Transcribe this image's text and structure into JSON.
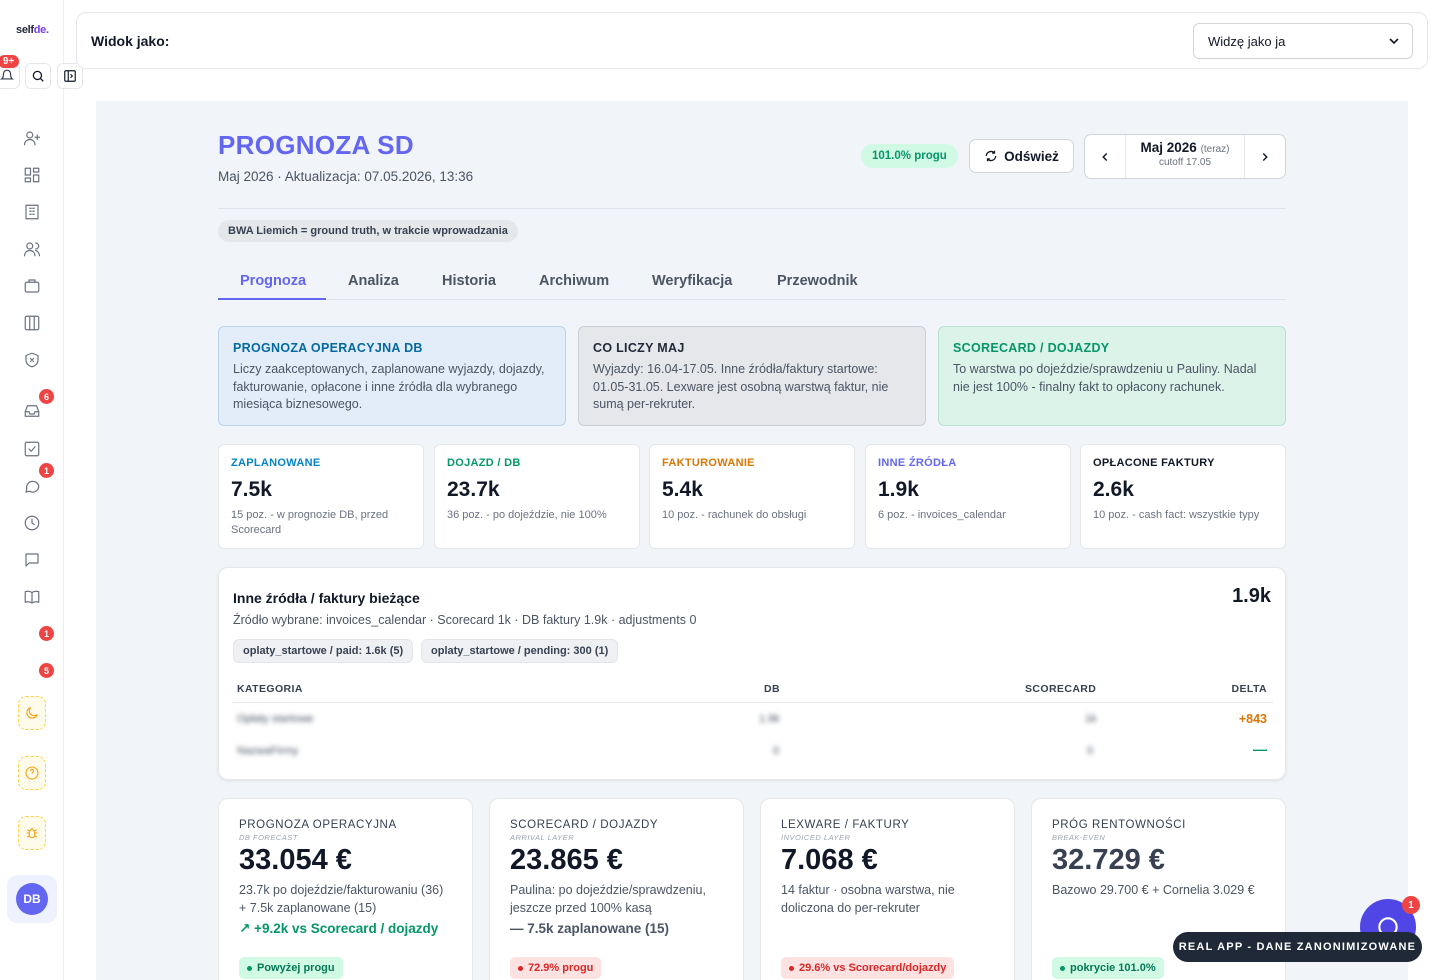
{
  "sidebar": {
    "logo_main": "self",
    "logo_accent": "de.",
    "top_badge": "9+",
    "badges": {
      "inbox": "6",
      "chat": "1",
      "item_a": "1",
      "item_b": "5"
    },
    "avatar": "DB"
  },
  "topbar": {
    "label": "Widok jako:",
    "select_value": "Widzę jako ja"
  },
  "header": {
    "title": "PROGNOZA SD",
    "subtitle": "Maj 2026 · Aktualizacja: 07.05.2026, 13:36",
    "threshold_pill": "101.0% progu",
    "refresh_label": "Odśwież",
    "month_label": "Maj 2026",
    "month_now": "(teraz)",
    "cutoff": "cutoff 17.05",
    "note_chip": "BWA Liemich = ground truth, w trakcie wprowadzania"
  },
  "tabs": [
    "Prognoza",
    "Analiza",
    "Historia",
    "Archiwum",
    "Weryfikacja",
    "Przewodnik"
  ],
  "info_boxes": [
    {
      "title": "PROGNOZA OPERACYJNA DB",
      "text": "Liczy zaakceptowanych, zaplanowane wyjazdy, dojazdy, fakturowanie, opłacone i inne źródła dla wybranego miesiąca biznesowego."
    },
    {
      "title": "CO LICZY MAJ",
      "text": "Wyjazdy: 16.04-17.05. Inne źródła/faktury startowe: 01.05-31.05. Lexware jest osobną warstwą faktur, nie sumą per-rekruter."
    },
    {
      "title": "SCORECARD / DOJAZDY",
      "text": "To warstwa po dojeździe/sprawdzeniu u Pauliny. Nadal nie jest 100% - finalny fakt to opłacony rachunek."
    }
  ],
  "kpis": [
    {
      "title": "ZAPLANOWANE",
      "value": "7.5k",
      "sub": "15 poz. - w prognozie DB, przed Scorecard",
      "color": "#0284c7"
    },
    {
      "title": "DOJAZD / DB",
      "value": "23.7k",
      "sub": "36 poz. - po dojeździe, nie 100%",
      "color": "#059669"
    },
    {
      "title": "FAKTUROWANIE",
      "value": "5.4k",
      "sub": "10 poz. - rachunek do obsługi",
      "color": "#d97706"
    },
    {
      "title": "INNE ŹRÓDŁA",
      "value": "1.9k",
      "sub": "6 poz. - invoices_calendar",
      "color": "#6366f1"
    },
    {
      "title": "OPŁACONE FAKTURY",
      "value": "2.6k",
      "sub": "10 poz. - cash fact: wszystkie typy",
      "color": "#111827"
    }
  ],
  "sources": {
    "title": "Inne źródła / faktury bieżące",
    "subtitle": "Źródło wybrane: invoices_calendar · Scorecard 1k · DB faktury 1.9k · adjustments 0",
    "total": "1.9k",
    "chips": [
      "oplaty_startowe / paid: 1.6k (5)",
      "oplaty_startowe / pending: 300 (1)"
    ],
    "headers": {
      "category": "KATEGORIA",
      "db": "DB",
      "scorecard": "SCORECARD",
      "delta": "DELTA"
    },
    "rows": [
      {
        "category": "Opłaty startowe",
        "db": "1.9k",
        "scorecard": "1k",
        "delta": "+843"
      },
      {
        "category": "NazwaFirmy",
        "db": "0",
        "scorecard": "0",
        "delta": "—"
      }
    ]
  },
  "big_cards": [
    {
      "title": "PROGNOZA OPERACYJNA",
      "tag": "DB FORECAST",
      "value": "33.054 €",
      "desc": "23.7k po dojeździe/fakturowaniu (36) + 7.5k zaplanowane (15)",
      "extra": "↗ +9.2k vs Scorecard / dojazdy",
      "badge": "Powyżej progu"
    },
    {
      "title": "SCORECARD / DOJAZDY",
      "tag": "ARRIVAL LAYER",
      "value": "23.865 €",
      "desc": "Paulina: po dojeździe/sprawdzeniu, jeszcze przed 100% kasą",
      "extra": "— 7.5k zaplanowane (15)",
      "badge": "72.9% progu"
    },
    {
      "title": "LEXWARE / FAKTURY",
      "tag": "INVOICED LAYER",
      "value": "7.068 €",
      "desc": "14 faktur · osobna warstwa, nie doliczona do per-rekruter",
      "extra": "",
      "badge": "29.6% vs Scorecard/dojazdy"
    },
    {
      "title": "PRÓG RENTOWNOŚCI",
      "tag": "BREAK-EVEN",
      "value": "32.729 €",
      "desc": "Bazowo 29.700 € + Cornelia 3.029 €",
      "extra": "",
      "badge": "pokrycie 101.0%"
    }
  ],
  "floating": {
    "chat_badge": "1",
    "real_app_label": "REAL APP - DANE ZANONIMIZOWANE"
  },
  "colors": {
    "accent": "#6366f1",
    "positive": "#059669",
    "negative": "#dc2626",
    "warning": "#d97706"
  }
}
